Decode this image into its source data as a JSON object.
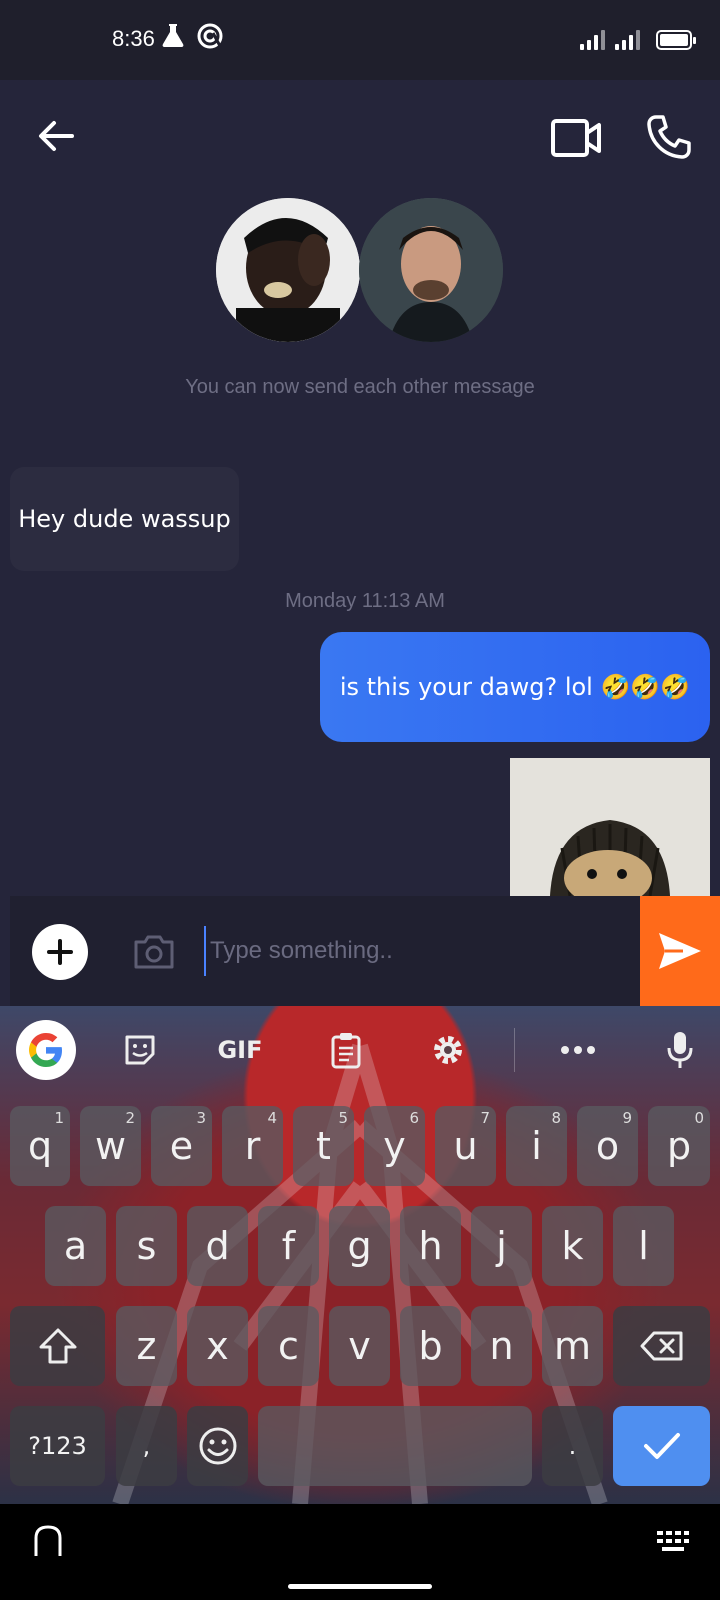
{
  "status_bar": {
    "time": "8:36",
    "icons": [
      "flask-icon",
      "sync-icon",
      "signal-icon",
      "signal-icon",
      "battery-icon"
    ]
  },
  "header": {
    "back_icon": "arrow-left-icon",
    "video_icon": "video-call-icon",
    "call_icon": "phone-icon"
  },
  "chat": {
    "info": "You can now send each other message",
    "messages": [
      {
        "direction": "incoming",
        "text": "Hey dude wassup"
      },
      {
        "direction": "outgoing",
        "text": "is this your dawg? lol 🤣🤣🤣"
      },
      {
        "direction": "outgoing",
        "type": "image"
      }
    ],
    "timestamp": "Monday 11:13 AM"
  },
  "composer": {
    "placeholder": "Type something..",
    "value": "",
    "add_icon": "plus-icon",
    "camera_icon": "camera-icon",
    "send_icon": "send-icon"
  },
  "keyboard": {
    "toolbar": [
      "google-icon",
      "sticker-icon",
      "GIF",
      "clipboard-icon",
      "gear-icon",
      "more-icon",
      "mic-icon"
    ],
    "row1": [
      {
        "k": "q",
        "h": "1"
      },
      {
        "k": "w",
        "h": "2"
      },
      {
        "k": "e",
        "h": "3"
      },
      {
        "k": "r",
        "h": "4"
      },
      {
        "k": "t",
        "h": "5"
      },
      {
        "k": "y",
        "h": "6"
      },
      {
        "k": "u",
        "h": "7"
      },
      {
        "k": "i",
        "h": "8"
      },
      {
        "k": "o",
        "h": "9"
      },
      {
        "k": "p",
        "h": "0"
      }
    ],
    "row2": [
      "a",
      "s",
      "d",
      "f",
      "g",
      "h",
      "j",
      "k",
      "l"
    ],
    "row3": [
      "z",
      "x",
      "c",
      "v",
      "b",
      "n",
      "m"
    ],
    "symbols_key": "?123",
    "comma_key": ",",
    "period_key": ".",
    "accent": "#4f8ff0"
  },
  "colors": {
    "background": "#25253a",
    "outgoing_bubble": "#3a78f2",
    "send_button": "#ff6a1a"
  }
}
